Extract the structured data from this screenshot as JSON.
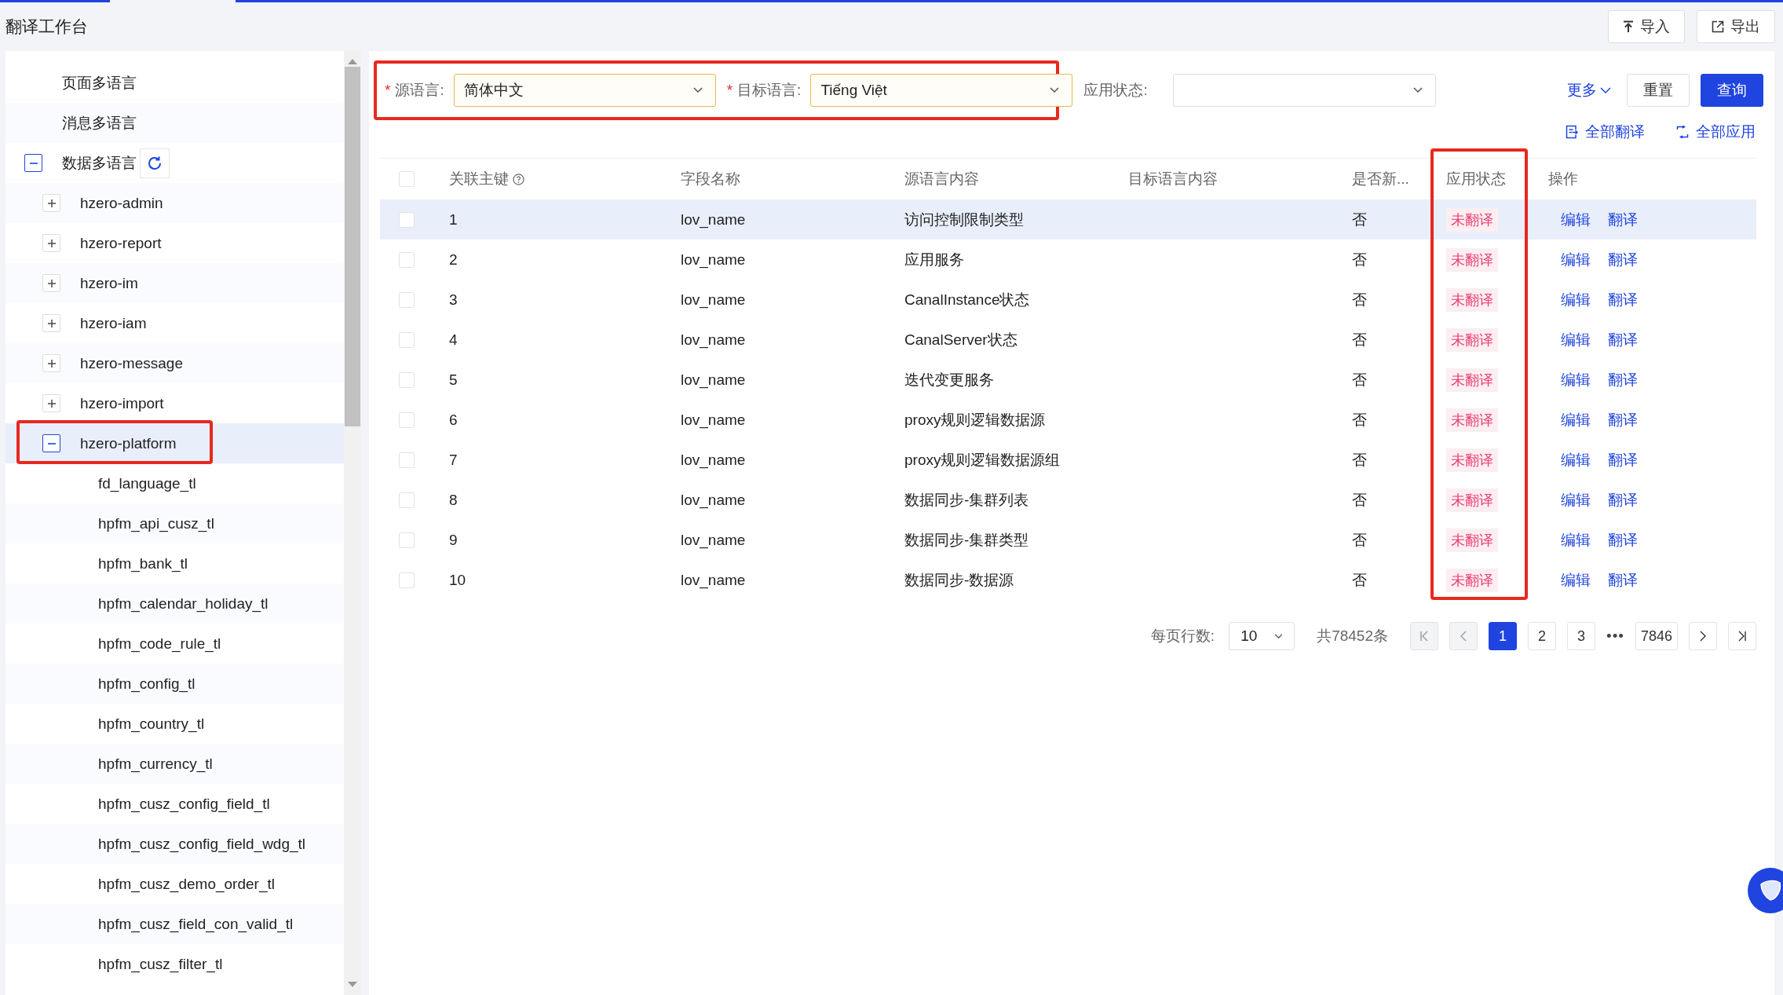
{
  "page_title": "翻译工作台",
  "header_actions": [
    {
      "kind": "import",
      "label": "导入"
    },
    {
      "kind": "export",
      "label": "导出"
    }
  ],
  "tree": [
    {
      "label": "页面多语言",
      "selected": false
    },
    {
      "label": "消息多语言",
      "selected": false
    },
    {
      "label": "数据多语言",
      "selected": false,
      "expanded": true,
      "refresh": true,
      "children": [
        {
          "label": "hzero-admin",
          "selected": false,
          "expanded": false
        },
        {
          "label": "hzero-report",
          "selected": false,
          "expanded": false
        },
        {
          "label": "hzero-im",
          "selected": false,
          "expanded": false
        },
        {
          "label": "hzero-iam",
          "selected": false,
          "expanded": false
        },
        {
          "label": "hzero-message",
          "selected": false,
          "expanded": false
        },
        {
          "label": "hzero-import",
          "selected": false,
          "expanded": false
        },
        {
          "label": "hzero-platform",
          "selected": true,
          "expanded": true,
          "highlight": true,
          "children": [
            {
              "label": "fd_language_tl",
              "selected": false
            },
            {
              "label": "hpfm_api_cusz_tl",
              "selected": false
            },
            {
              "label": "hpfm_bank_tl",
              "selected": false
            },
            {
              "label": "hpfm_calendar_holiday_tl",
              "selected": false
            },
            {
              "label": "hpfm_code_rule_tl",
              "selected": false
            },
            {
              "label": "hpfm_config_tl",
              "selected": false
            },
            {
              "label": "hpfm_country_tl",
              "selected": false
            },
            {
              "label": "hpfm_currency_tl",
              "selected": false
            },
            {
              "label": "hpfm_cusz_config_field_tl",
              "selected": false
            },
            {
              "label": "hpfm_cusz_config_field_wdg_tl",
              "selected": false
            },
            {
              "label": "hpfm_cusz_demo_order_tl",
              "selected": false
            },
            {
              "label": "hpfm_cusz_field_con_valid_tl",
              "selected": false
            },
            {
              "label": "hpfm_cusz_filter_tl",
              "selected": false
            }
          ]
        }
      ]
    }
  ],
  "filters": [
    {
      "label": "源语言:",
      "required_mark": "*",
      "value": "简体中文",
      "highlight": true
    },
    {
      "label": "目标语言:",
      "required_mark": "*",
      "value": "Tiếng Việt",
      "highlight": true
    },
    {
      "label": "应用状态:"
    }
  ],
  "filter_buttons": [
    {
      "kind": "more",
      "label": "更多"
    },
    {
      "kind": "default",
      "label": "重置"
    },
    {
      "kind": "primary",
      "label": "查询"
    }
  ],
  "bulk_actions": [
    {
      "kind": "translate",
      "label": "全部翻译"
    },
    {
      "kind": "apply",
      "label": "全部应用"
    }
  ],
  "table": {
    "header_checked": false,
    "columns": [
      {
        "label": "关联主键",
        "help": true
      },
      {
        "label": "字段名称"
      },
      {
        "label": "源语言内容"
      },
      {
        "label": "目标语言内容"
      },
      {
        "label": "是否新..."
      },
      {
        "label": "应用状态",
        "highlight": true
      },
      {
        "label": "操作"
      }
    ],
    "rows": [
      {
        "selected": true,
        "checked": false,
        "key": "1",
        "field": "lov_name",
        "source": "访问控制限制类型",
        "is_new": "否",
        "status": "未翻译",
        "actions": [
          "编辑",
          "翻译"
        ]
      },
      {
        "selected": false,
        "checked": false,
        "key": "2",
        "field": "lov_name",
        "source": "应用服务",
        "is_new": "否",
        "status": "未翻译",
        "actions": [
          "编辑",
          "翻译"
        ]
      },
      {
        "selected": false,
        "checked": false,
        "key": "3",
        "field": "lov_name",
        "source": "CanalInstance状态",
        "is_new": "否",
        "status": "未翻译",
        "actions": [
          "编辑",
          "翻译"
        ]
      },
      {
        "selected": false,
        "checked": false,
        "key": "4",
        "field": "lov_name",
        "source": "CanalServer状态",
        "is_new": "否",
        "status": "未翻译",
        "actions": [
          "编辑",
          "翻译"
        ]
      },
      {
        "selected": false,
        "checked": false,
        "key": "5",
        "field": "lov_name",
        "source": "迭代变更服务",
        "is_new": "否",
        "status": "未翻译",
        "actions": [
          "编辑",
          "翻译"
        ]
      },
      {
        "selected": false,
        "checked": false,
        "key": "6",
        "field": "lov_name",
        "source": "proxy规则逻辑数据源",
        "is_new": "否",
        "status": "未翻译",
        "actions": [
          "编辑",
          "翻译"
        ]
      },
      {
        "selected": false,
        "checked": false,
        "key": "7",
        "field": "lov_name",
        "source": "proxy规则逻辑数据源组",
        "is_new": "否",
        "status": "未翻译",
        "actions": [
          "编辑",
          "翻译"
        ]
      },
      {
        "selected": false,
        "checked": false,
        "key": "8",
        "field": "lov_name",
        "source": "数据同步-集群列表",
        "is_new": "否",
        "status": "未翻译",
        "actions": [
          "编辑",
          "翻译"
        ]
      },
      {
        "selected": false,
        "checked": false,
        "key": "9",
        "field": "lov_name",
        "source": "数据同步-集群类型",
        "is_new": "否",
        "status": "未翻译",
        "actions": [
          "编辑",
          "翻译"
        ]
      },
      {
        "selected": false,
        "checked": false,
        "key": "10",
        "field": "lov_name",
        "source": "数据同步-数据源",
        "is_new": "否",
        "status": "未翻译",
        "actions": [
          "编辑",
          "翻译"
        ]
      }
    ]
  },
  "pagination": {
    "page_size_label": "每页行数:",
    "page_size": "10",
    "total": "共78452条",
    "nav": [
      {
        "kind": "first",
        "disabled": true
      },
      {
        "kind": "prev",
        "disabled": true
      }
    ],
    "pages": [
      {
        "label": "1",
        "selected": true
      },
      {
        "label": "2",
        "selected": false
      },
      {
        "label": "3",
        "selected": false
      },
      {
        "label": "•••",
        "kind": "ellipsis"
      },
      {
        "label": "7846",
        "selected": false
      }
    ],
    "nav_end": [
      {
        "kind": "next",
        "disabled": false
      },
      {
        "kind": "last",
        "disabled": false
      }
    ]
  }
}
